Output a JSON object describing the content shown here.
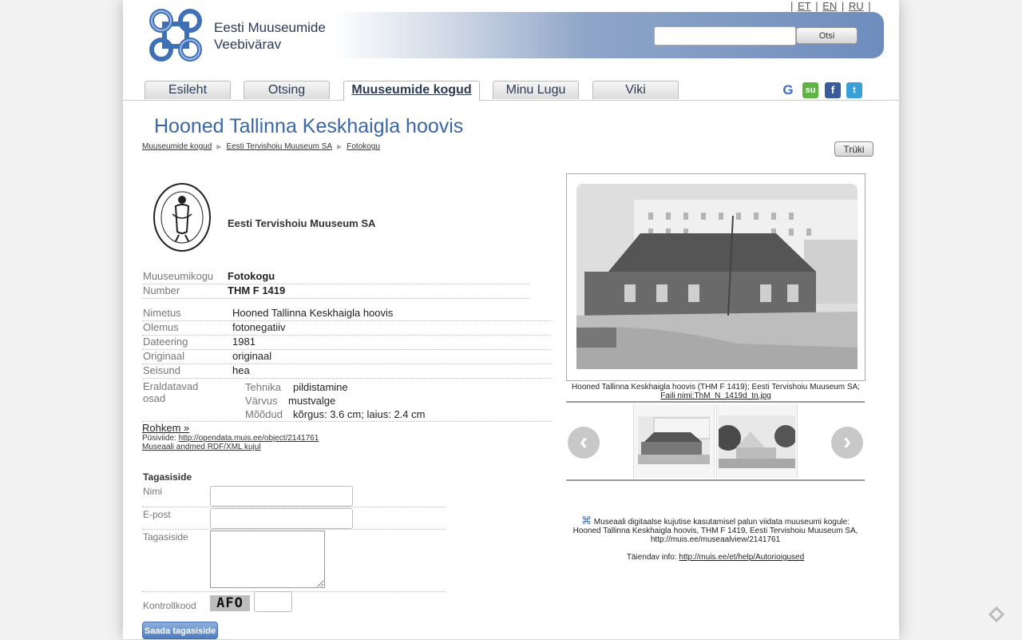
{
  "header": {
    "languages": [
      "ET",
      "EN",
      "RU"
    ],
    "site_name_line1": "Eesti Muuseumide",
    "site_name_line2": "Veebivärav",
    "search_button": "Otsi",
    "search_value": ""
  },
  "nav": {
    "tabs": [
      {
        "label": "Esileht",
        "active": false
      },
      {
        "label": "Otsing",
        "active": false
      },
      {
        "label": "Muuseumide kogud",
        "active": true
      },
      {
        "label": "Minu Lugu",
        "active": false
      },
      {
        "label": "Viki",
        "active": false
      }
    ],
    "social_icons": [
      "google-icon",
      "stumbleupon-icon",
      "facebook-icon",
      "twitter-icon"
    ]
  },
  "page": {
    "title": "Hooned Tallinna Keskhaigla hoovis",
    "breadcrumb": [
      "Muuseumide kogud",
      "Eesti Tervishoiu Muuseum SA",
      "Fotokogu"
    ],
    "print_button": "Trüki",
    "museum_name": "Eesti Tervishoiu Muuseum SA"
  },
  "details": {
    "collection_label": "Muuseumikogu",
    "collection_value": "Fotokogu",
    "number_label": "Number",
    "number_value": "THM F 1419",
    "fields": [
      {
        "label": "Nimetus",
        "value": "Hooned Tallinna Keskhaigla hoovis"
      },
      {
        "label": "Olemus",
        "value": "fotonegatiiv"
      },
      {
        "label": "Dateering",
        "value": "1981"
      },
      {
        "label": "Originaal",
        "value": "originaal"
      },
      {
        "label": "Seisund",
        "value": "hea"
      }
    ],
    "parts_label_line1": "Eraldatavad",
    "parts_label_line2": "osad",
    "parts": [
      {
        "label": "Tehnika",
        "value": "pildistamine"
      },
      {
        "label": "Värvus",
        "value": "mustvalge"
      },
      {
        "label": "Mõõdud",
        "value": "kõrgus: 3.6 cm; laius: 2.4 cm"
      }
    ],
    "more_link": "Rohkem »",
    "permalink_label": "Püsiviide:",
    "permalink_url": "http://opendata.muis.ee/object/2141761",
    "rdf_link": "Museaali andmed RDF/XML kujul"
  },
  "image": {
    "caption_line1": "Hooned Tallinna Keskhaigla hoovis (THM F 1419); Eesti Tervishoiu Muuseum SA;",
    "caption_line2": "Faili nimi:ThM_N_1419d_tn.jpg"
  },
  "usage": {
    "line1": "Museaali digitaalse kujutise kasutamisel palun viidata muuseumi kogule:",
    "line2": "Hooned Tallinna Keskhaigla hoovis, THM F 1419, Eesti Tervishoiu Muuseum SA,",
    "line3": "http://muis.ee/museaalview/2141761",
    "extra_label": "Täiendav info:",
    "extra_link": "http://muis.ee/et/help/Autorioigused"
  },
  "feedback": {
    "title": "Tagasiside",
    "name_label": "Nimi",
    "email_label": "E-post",
    "message_label": "Tagasiside",
    "captcha_label": "Kontrollkood",
    "captcha_text": "AFO",
    "submit": "Saada tagasiside"
  }
}
